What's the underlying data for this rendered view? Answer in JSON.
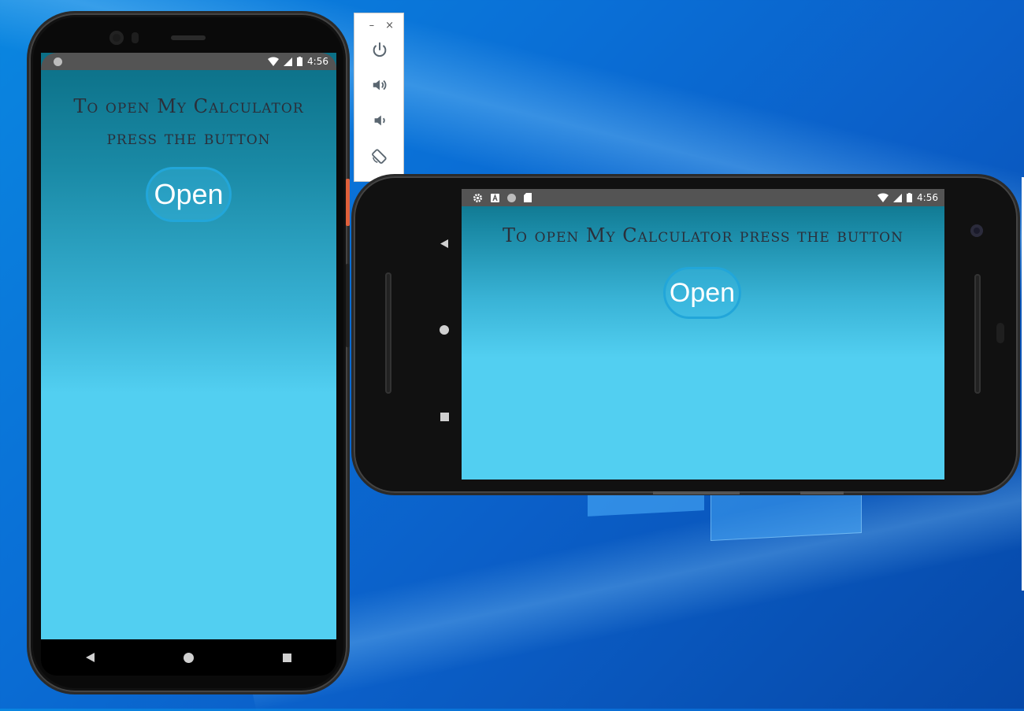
{
  "desktop": {
    "accent": "#0a6fd6"
  },
  "emulator_toolbar": {
    "minimize_label": "–",
    "close_label": "×",
    "buttons": [
      "power-icon",
      "volume-up-icon",
      "volume-down-icon",
      "rotate-icon"
    ]
  },
  "portrait_device": {
    "status_bar": {
      "time": "4:56",
      "left_icons": [
        "circle-icon"
      ],
      "right_icons": [
        "wifi-icon",
        "signal-icon",
        "battery-icon"
      ]
    },
    "message_line1": "To open My Calculator",
    "message_line2": "press the button",
    "open_button_label": "Open",
    "nav_icons": [
      "back-icon",
      "home-icon",
      "recents-icon"
    ]
  },
  "landscape_device": {
    "status_bar": {
      "time": "4:56",
      "left_icons": [
        "gear-icon",
        "a-icon",
        "circle-icon",
        "sd-card-icon"
      ],
      "right_icons": [
        "wifi-icon",
        "signal-icon",
        "battery-icon"
      ]
    },
    "message": "To open My Calculator press the button",
    "open_button_label": "Open",
    "nav_icons": [
      "back-icon",
      "home-icon",
      "recents-icon"
    ]
  },
  "colors": {
    "screen_top": "#0b6f86",
    "screen_bottom": "#52cff1",
    "button_border": "#22a6d9",
    "text": "#2b2f3a"
  }
}
